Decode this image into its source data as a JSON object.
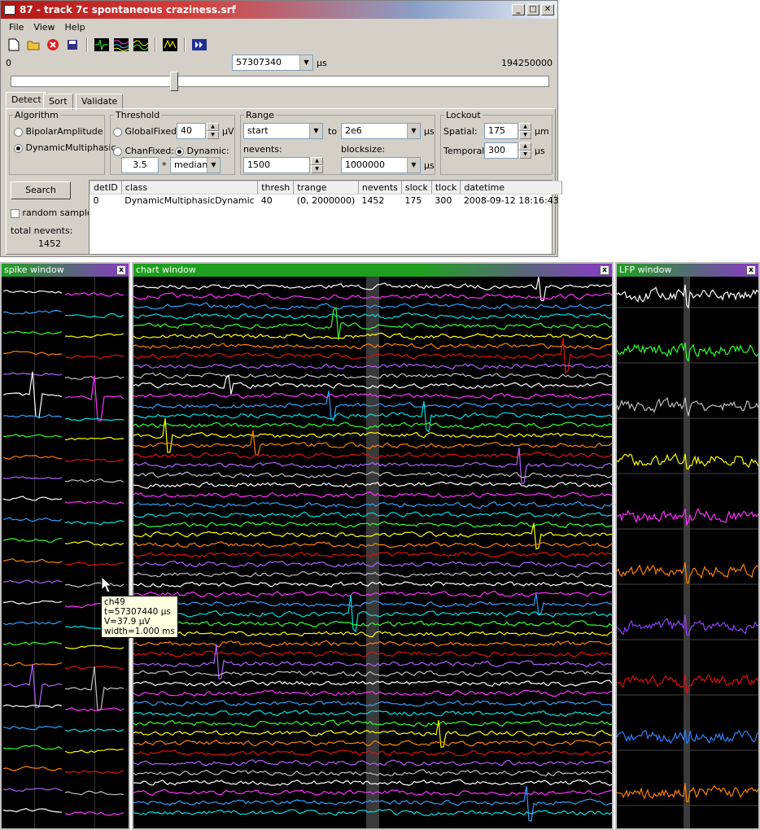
{
  "window": {
    "title": "87 - track 7c spontaneous craziness.srf"
  },
  "menu": [
    "File",
    "View",
    "Help"
  ],
  "toolbar": {
    "icons": [
      "new-file-icon",
      "open-folder-icon",
      "close-icon",
      "save-icon",
      "spike-window-icon",
      "chart-window-icon",
      "lfp-window-icon",
      "sort-icon",
      "play-icon"
    ]
  },
  "timeline": {
    "start": "0",
    "end": "194250000",
    "current": "57307340",
    "unit": "µs",
    "slider_fraction": 0.295
  },
  "tabs": [
    "Detect",
    "Sort",
    "Validate"
  ],
  "algorithm": {
    "legend": "Algorithm",
    "options": [
      "BipolarAmplitude",
      "DynamicMultiphasic"
    ],
    "selected": "DynamicMultiphasic"
  },
  "threshold": {
    "legend": "Threshold",
    "global_label": "GlobalFixed:",
    "global_value": "40",
    "global_unit": "µV",
    "chan_label": "ChanFixed:",
    "dynamic_label": "Dynamic:",
    "mult_value": "3.5",
    "times": "*",
    "stat_value": "median"
  },
  "range": {
    "legend": "Range",
    "start_value": "start",
    "to": "to",
    "end_value": "2e6",
    "unit": "µs",
    "nevents_label": "nevents:",
    "nevents_value": "1500",
    "blocksize_label": "blocksize:",
    "blocksize_value": "1000000",
    "blocksize_unit": "µs"
  },
  "lockout": {
    "legend": "Lockout",
    "spatial_label": "Spatial:",
    "spatial_value": "175",
    "spatial_unit": "µm",
    "temporal_label": "Temporal:",
    "temporal_value": "300",
    "temporal_unit": "µs"
  },
  "search": {
    "button": "Search",
    "random_label": "random sample",
    "total_label": "total nevents:",
    "total_value": "1452"
  },
  "detections": {
    "columns": [
      "detID",
      "class",
      "thresh",
      "trange",
      "nevents",
      "slock",
      "tlock",
      "datetime"
    ],
    "rows": [
      [
        "0",
        "DynamicMultiphasicDynamic",
        "40",
        "(0, 2000000)",
        "1452",
        "175",
        "300",
        "2008-09-12 18:16:43"
      ]
    ]
  },
  "panes": {
    "spike": {
      "title": "spike window",
      "close": "x"
    },
    "chart": {
      "title": "chart window",
      "close": "x"
    },
    "lfp": {
      "title": "LFP window",
      "close": "x"
    }
  },
  "tooltip": {
    "ch": "ch49",
    "t": "t=57307440 µs",
    "v": "V=37.9 µV",
    "width": "width=1.000 ms"
  },
  "colors": {
    "trace_palette": [
      "#ffffff",
      "#ff30ff",
      "#30a0ff",
      "#00e0e0",
      "#30ff30",
      "#ffff00",
      "#ff8000",
      "#e01010",
      "#b060ff",
      "#c0c0c0"
    ],
    "title_gradient_start": "#b41414",
    "pane_title_spike": "#8a38c8",
    "pane_title_chart": "#1ea01e",
    "pane_title_lfp": "#1ea01e"
  }
}
